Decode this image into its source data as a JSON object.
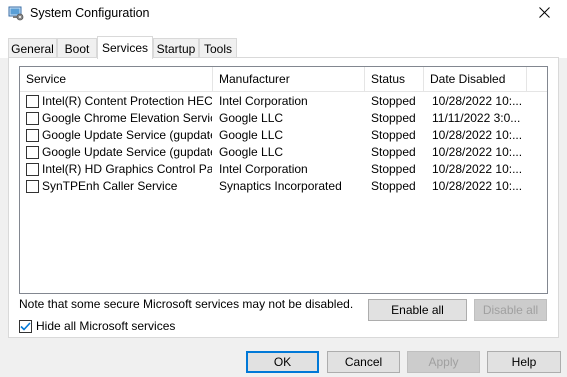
{
  "window": {
    "title": "System Configuration"
  },
  "tabs": [
    {
      "label": "General"
    },
    {
      "label": "Boot"
    },
    {
      "label": "Services"
    },
    {
      "label": "Startup"
    },
    {
      "label": "Tools"
    }
  ],
  "services": {
    "columns": {
      "service": "Service",
      "manufacturer": "Manufacturer",
      "status": "Status",
      "date_disabled": "Date Disabled"
    },
    "rows": [
      {
        "service": "Intel(R) Content Protection HEC...",
        "manufacturer": "Intel Corporation",
        "status": "Stopped",
        "date": "10/28/2022 10:..."
      },
      {
        "service": "Google Chrome Elevation Servic...",
        "manufacturer": "Google LLC",
        "status": "Stopped",
        "date": "11/11/2022 3:0..."
      },
      {
        "service": "Google Update Service (gupdate)",
        "manufacturer": "Google LLC",
        "status": "Stopped",
        "date": "10/28/2022 10:..."
      },
      {
        "service": "Google Update Service (gupdatem)",
        "manufacturer": "Google LLC",
        "status": "Stopped",
        "date": "10/28/2022 10:..."
      },
      {
        "service": "Intel(R) HD Graphics Control Pa...",
        "manufacturer": "Intel Corporation",
        "status": "Stopped",
        "date": "10/28/2022 10:..."
      },
      {
        "service": "SynTPEnh Caller Service",
        "manufacturer": "Synaptics Incorporated",
        "status": "Stopped",
        "date": "10/28/2022 10:..."
      }
    ],
    "note": "Note that some secure Microsoft services may not be disabled.",
    "enable_all": "Enable all",
    "disable_all": "Disable all",
    "hide_ms_label": "Hide all Microsoft services"
  },
  "footer": {
    "ok": "OK",
    "cancel": "Cancel",
    "apply": "Apply",
    "help": "Help"
  },
  "colors": {
    "accent": "#0078d7",
    "checkmark": "#0078d7"
  }
}
